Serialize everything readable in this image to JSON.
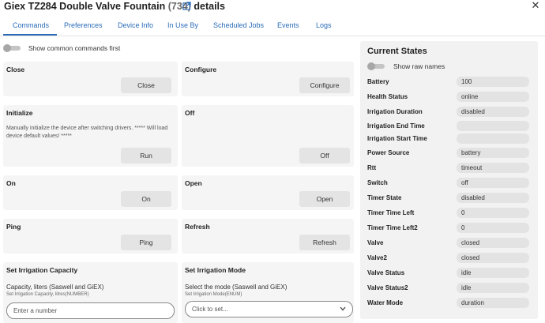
{
  "header": {
    "title": "Giex TZ284 Double Valve Fountain",
    "count": "(734)",
    "details": "details"
  },
  "tabs": [
    {
      "label": "Commands"
    },
    {
      "label": "Preferences"
    },
    {
      "label": "Device Info"
    },
    {
      "label": "In Use By"
    },
    {
      "label": "Scheduled Jobs"
    },
    {
      "label": "Events"
    },
    {
      "label": "Logs"
    }
  ],
  "common_toggle": {
    "label": "Show common commands first"
  },
  "commands": {
    "close": {
      "title": "Close",
      "button": "Close"
    },
    "configure": {
      "title": "Configure",
      "button": "Configure"
    },
    "initialize": {
      "title": "Initialize",
      "description": "Manually initialize the device after switching drivers. ***** Will load device default values! *****",
      "button": "Run"
    },
    "off": {
      "title": "Off",
      "button": "Off"
    },
    "on": {
      "title": "On",
      "button": "On"
    },
    "open": {
      "title": "Open",
      "button": "Open"
    },
    "ping": {
      "title": "Ping",
      "button": "Ping"
    },
    "refresh": {
      "title": "Refresh",
      "button": "Refresh"
    },
    "irrigation_capacity": {
      "title": "Set Irrigation Capacity",
      "param_label": "Capacity, liters (Saswell and GiEX)",
      "param_sub": "Set Irrigation Capacity, litres(NUMBER)",
      "placeholder": "Enter a number"
    },
    "irrigation_mode": {
      "title": "Set Irrigation Mode",
      "param_label": "Select the mode (Saswell and GiEX)",
      "param_sub": "Set Irrigation Mode(ENUM)",
      "selected": "Click to set..."
    }
  },
  "current_states": {
    "title": "Current States",
    "raw_toggle_label": "Show raw names",
    "rows": [
      {
        "name": "Battery",
        "value": "100"
      },
      {
        "name": "Health Status",
        "value": "online"
      },
      {
        "name": "Irrigation Duration",
        "value": "disabled"
      },
      {
        "name": "Irrigation End Time",
        "value": ""
      },
      {
        "name": "Irrigation Start Time",
        "value": ""
      },
      {
        "name": "Power Source",
        "value": "battery"
      },
      {
        "name": "Rtt",
        "value": "timeout"
      },
      {
        "name": "Switch",
        "value": "off"
      },
      {
        "name": "Timer State",
        "value": "disabled"
      },
      {
        "name": "Timer Time Left",
        "value": "0"
      },
      {
        "name": "Timer Time Left2",
        "value": "0"
      },
      {
        "name": "Valve",
        "value": "closed"
      },
      {
        "name": "Valve2",
        "value": "closed"
      },
      {
        "name": "Valve Status",
        "value": "idle"
      },
      {
        "name": "Valve Status2",
        "value": "idle"
      },
      {
        "name": "Water Mode",
        "value": "duration"
      }
    ]
  },
  "colors": {
    "accent": "#2b6cb8",
    "card_bg": "#f5f5f5",
    "state_bg": "#f2f2f2"
  },
  "icons": {
    "external": "external-link-icon",
    "close": "close-icon",
    "chevron": "chevron-down-icon"
  }
}
